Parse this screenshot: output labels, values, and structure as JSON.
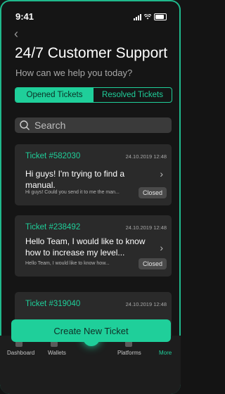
{
  "status_bar": {
    "time": "9:41"
  },
  "header": {
    "back_symbol": "‹",
    "title": "24/7 Customer Support",
    "subtitle": "How can we help you today?"
  },
  "tabs": [
    {
      "label": "Opened Tickets",
      "active": true
    },
    {
      "label": "Resolved Tickets",
      "active": false
    }
  ],
  "search": {
    "placeholder": "Search"
  },
  "tickets": [
    {
      "id": "Ticket #582030",
      "date": "24.10.2019 12:48",
      "message": "Hi guys! I'm trying to find a manual.",
      "preview": "Hi guys! Could you send it to me the man...",
      "status": "Closed"
    },
    {
      "id": "Ticket #238492",
      "date": "24.10.2019 12:48",
      "message": "Hello Team, I would like to know how to increase my level...",
      "preview": "Hello Team, I would like to know how...",
      "status": "Closed"
    },
    {
      "id": "Ticket #319040",
      "date": "24.10.2019 12:48",
      "message": "",
      "preview": "",
      "status": ""
    }
  ],
  "create_button": {
    "label": "Create New Ticket"
  },
  "bottom_nav": [
    {
      "label": "Dashboard",
      "active": false
    },
    {
      "label": "Wallets",
      "active": false
    },
    {
      "label": "Platforms",
      "active": false
    },
    {
      "label": "More",
      "active": true
    }
  ],
  "colors": {
    "accent": "#1fcf9a",
    "background": "#151515",
    "card": "#2a2a2a"
  }
}
